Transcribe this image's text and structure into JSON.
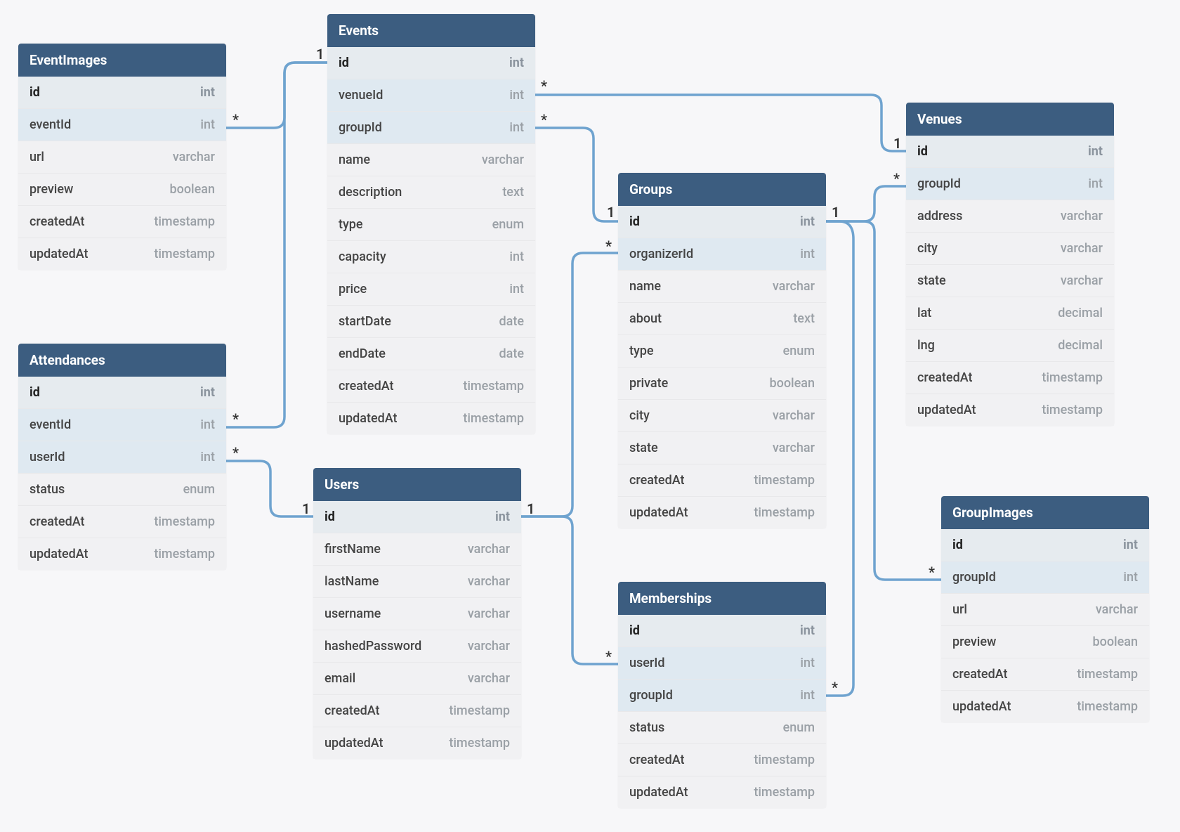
{
  "colors": {
    "header_bg": "#3c5d80",
    "row_bg": "#f1f1f3",
    "pk_bg": "#e6ebef",
    "fk_bg": "#dfe9f1",
    "connector": "#6fa3cf"
  },
  "entities": {
    "eventImages": {
      "title": "EventImages",
      "fields": [
        {
          "name": "id",
          "type": "int",
          "kind": "pk"
        },
        {
          "name": "eventId",
          "type": "int",
          "kind": "fk"
        },
        {
          "name": "url",
          "type": "varchar",
          "kind": ""
        },
        {
          "name": "preview",
          "type": "boolean",
          "kind": ""
        },
        {
          "name": "createdAt",
          "type": "timestamp",
          "kind": ""
        },
        {
          "name": "updatedAt",
          "type": "timestamp",
          "kind": ""
        }
      ]
    },
    "events": {
      "title": "Events",
      "fields": [
        {
          "name": "id",
          "type": "int",
          "kind": "pk"
        },
        {
          "name": "venueId",
          "type": "int",
          "kind": "fk"
        },
        {
          "name": "groupId",
          "type": "int",
          "kind": "fk"
        },
        {
          "name": "name",
          "type": "varchar",
          "kind": ""
        },
        {
          "name": "description",
          "type": "text",
          "kind": ""
        },
        {
          "name": "type",
          "type": "enum",
          "kind": ""
        },
        {
          "name": "capacity",
          "type": "int",
          "kind": ""
        },
        {
          "name": "price",
          "type": "int",
          "kind": ""
        },
        {
          "name": "startDate",
          "type": "date",
          "kind": ""
        },
        {
          "name": "endDate",
          "type": "date",
          "kind": ""
        },
        {
          "name": "createdAt",
          "type": "timestamp",
          "kind": ""
        },
        {
          "name": "updatedAt",
          "type": "timestamp",
          "kind": ""
        }
      ]
    },
    "attendances": {
      "title": "Attendances",
      "fields": [
        {
          "name": "id",
          "type": "int",
          "kind": "pk"
        },
        {
          "name": "eventId",
          "type": "int",
          "kind": "fk"
        },
        {
          "name": "userId",
          "type": "int",
          "kind": "fk"
        },
        {
          "name": "status",
          "type": "enum",
          "kind": ""
        },
        {
          "name": "createdAt",
          "type": "timestamp",
          "kind": ""
        },
        {
          "name": "updatedAt",
          "type": "timestamp",
          "kind": ""
        }
      ]
    },
    "users": {
      "title": "Users",
      "fields": [
        {
          "name": "id",
          "type": "int",
          "kind": "pk"
        },
        {
          "name": "firstName",
          "type": "varchar",
          "kind": ""
        },
        {
          "name": "lastName",
          "type": "varchar",
          "kind": ""
        },
        {
          "name": "username",
          "type": "varchar",
          "kind": ""
        },
        {
          "name": "hashedPassword",
          "type": "varchar",
          "kind": ""
        },
        {
          "name": "email",
          "type": "varchar",
          "kind": ""
        },
        {
          "name": "createdAt",
          "type": "timestamp",
          "kind": ""
        },
        {
          "name": "updatedAt",
          "type": "timestamp",
          "kind": ""
        }
      ]
    },
    "groups": {
      "title": "Groups",
      "fields": [
        {
          "name": "id",
          "type": "int",
          "kind": "pk"
        },
        {
          "name": "organizerId",
          "type": "int",
          "kind": "fk"
        },
        {
          "name": "name",
          "type": "varchar",
          "kind": ""
        },
        {
          "name": "about",
          "type": "text",
          "kind": ""
        },
        {
          "name": "type",
          "type": "enum",
          "kind": ""
        },
        {
          "name": "private",
          "type": "boolean",
          "kind": ""
        },
        {
          "name": "city",
          "type": "varchar",
          "kind": ""
        },
        {
          "name": "state",
          "type": "varchar",
          "kind": ""
        },
        {
          "name": "createdAt",
          "type": "timestamp",
          "kind": ""
        },
        {
          "name": "updatedAt",
          "type": "timestamp",
          "kind": ""
        }
      ]
    },
    "memberships": {
      "title": "Memberships",
      "fields": [
        {
          "name": "id",
          "type": "int",
          "kind": "pk"
        },
        {
          "name": "userId",
          "type": "int",
          "kind": "fk"
        },
        {
          "name": "groupId",
          "type": "int",
          "kind": "fk"
        },
        {
          "name": "status",
          "type": "enum",
          "kind": ""
        },
        {
          "name": "createdAt",
          "type": "timestamp",
          "kind": ""
        },
        {
          "name": "updatedAt",
          "type": "timestamp",
          "kind": ""
        }
      ]
    },
    "venues": {
      "title": "Venues",
      "fields": [
        {
          "name": "id",
          "type": "int",
          "kind": "pk"
        },
        {
          "name": "groupId",
          "type": "int",
          "kind": "fk"
        },
        {
          "name": "address",
          "type": "varchar",
          "kind": ""
        },
        {
          "name": "city",
          "type": "varchar",
          "kind": ""
        },
        {
          "name": "state",
          "type": "varchar",
          "kind": ""
        },
        {
          "name": "lat",
          "type": "decimal",
          "kind": ""
        },
        {
          "name": "lng",
          "type": "decimal",
          "kind": ""
        },
        {
          "name": "createdAt",
          "type": "timestamp",
          "kind": ""
        },
        {
          "name": "updatedAt",
          "type": "timestamp",
          "kind": ""
        }
      ]
    },
    "groupImages": {
      "title": "GroupImages",
      "fields": [
        {
          "name": "id",
          "type": "int",
          "kind": "pk"
        },
        {
          "name": "groupId",
          "type": "int",
          "kind": "fk"
        },
        {
          "name": "url",
          "type": "varchar",
          "kind": ""
        },
        {
          "name": "preview",
          "type": "boolean",
          "kind": ""
        },
        {
          "name": "createdAt",
          "type": "timestamp",
          "kind": ""
        },
        {
          "name": "updatedAt",
          "type": "timestamp",
          "kind": ""
        }
      ]
    }
  },
  "labels": {
    "one": "1",
    "many": "*"
  }
}
